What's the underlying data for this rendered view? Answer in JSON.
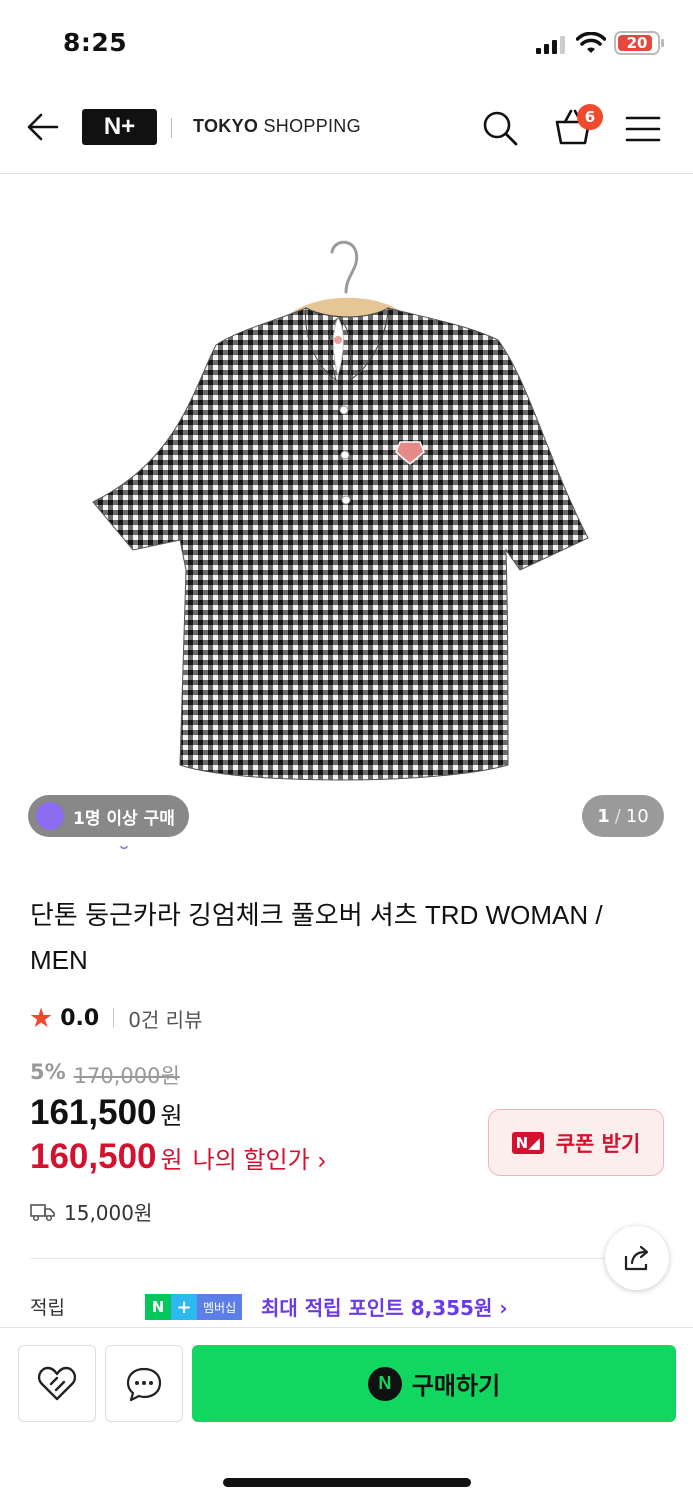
{
  "status_bar": {
    "time": "8:25",
    "battery": "20"
  },
  "header": {
    "logo_text": "N+",
    "brand_bold": "TOKYO",
    "brand_rest": " SHOPPING",
    "cart_count": "6"
  },
  "gallery": {
    "buyer_pill": "1명 이상 구매",
    "current": "1",
    "separator": "/",
    "total": "10"
  },
  "product": {
    "title": "단톤 둥근카라 깅엄체크 풀오버 셔츠 TRD WOMAN / MEN",
    "rating": "0.0",
    "review_count": "0건 리뷰",
    "discount_pct": "5%",
    "original_price": "170,000원",
    "price": "161,500",
    "price_unit": "원",
    "my_price": "160,500",
    "my_price_unit": "원",
    "my_price_label": "나의 할인가",
    "coupon_label": "쿠폰 받기",
    "shipping": "15,000원"
  },
  "points": {
    "label": "적립",
    "badge_n": "N",
    "badge_plus": "+",
    "badge_member": "멤버십",
    "text": "최대 적립 포인트 8,355원 ›"
  },
  "bottom": {
    "buy_label": "구매하기",
    "npay_icon": "N"
  },
  "colors": {
    "accent_red": "#d4122f",
    "buy_green": "#11d760",
    "points_purple": "#6b3be8",
    "badge_orange": "#f04a2e"
  }
}
